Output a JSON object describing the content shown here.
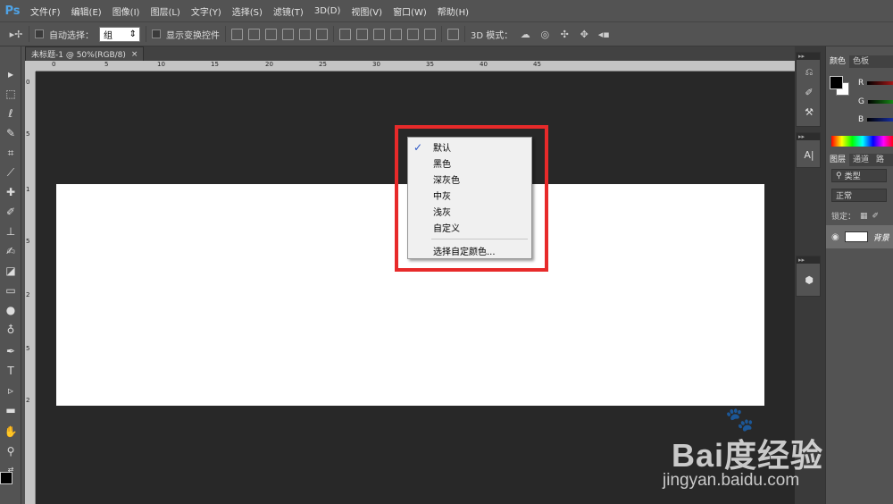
{
  "app": {
    "logo": "Ps"
  },
  "menubar": {
    "items": [
      "文件(F)",
      "编辑(E)",
      "图像(I)",
      "图层(L)",
      "文字(Y)",
      "选择(S)",
      "滤镜(T)",
      "3D(D)",
      "视图(V)",
      "窗口(W)",
      "帮助(H)"
    ]
  },
  "options": {
    "auto_select_label": "自动选择：",
    "auto_select_value": "组",
    "show_transform_label": "显示变换控件",
    "mode_3d_label": "3D 模式："
  },
  "document": {
    "tab_title": "未标题-1 @ 50%(RGB/8)",
    "close_glyph": "×"
  },
  "ruler": {
    "top_ticks": [
      "0",
      "5",
      "10",
      "15",
      "20",
      "25",
      "30",
      "35",
      "40",
      "45"
    ],
    "left_ticks": [
      "0",
      "5",
      "1",
      "5",
      "2",
      "5",
      "2"
    ]
  },
  "context_menu": {
    "items": [
      "默认",
      "黑色",
      "深灰色",
      "中灰",
      "浅灰",
      "自定义"
    ],
    "checked_item": "默认",
    "check_glyph": "✓",
    "custom_color_item": "选择自定颜色..."
  },
  "panels": {
    "color_tabs": [
      "颜色",
      "色板"
    ],
    "channels": [
      "R",
      "G",
      "B"
    ],
    "channel_colors": [
      "#e02020",
      "#20c020",
      "#2040e0"
    ],
    "layers_tabs": [
      "图层",
      "通道",
      "路"
    ],
    "filter_label": "类型",
    "blend_mode": "正常",
    "lock_label": "锁定：",
    "layer_name": "背景"
  },
  "watermark": {
    "brand": "Bai度经验",
    "url": "jingyan.baidu.com"
  }
}
